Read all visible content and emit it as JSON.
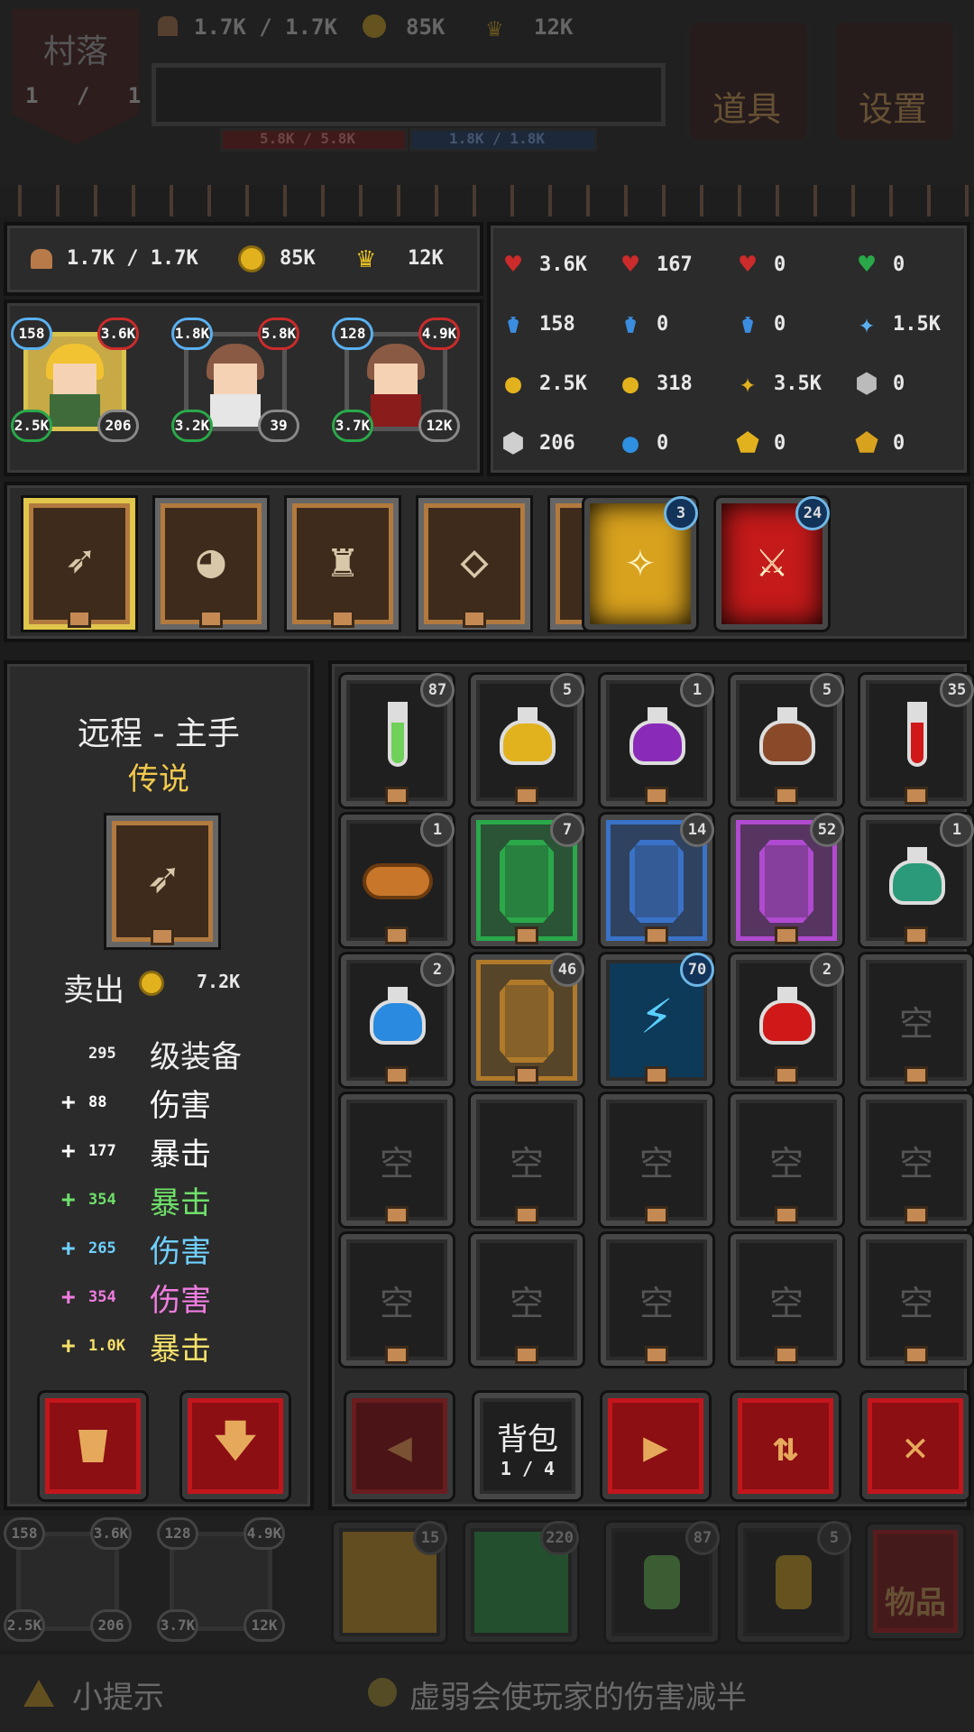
{
  "top": {
    "village": {
      "label": "村落",
      "count": "1 / 1"
    },
    "food": "1.7K / 1.7K",
    "gold": "85K",
    "crown": "12K",
    "hp_bar": "5.8K / 5.8K",
    "mp_bar": "1.8K / 1.8K",
    "items_label": "道具",
    "settings_label": "设置"
  },
  "resources": {
    "food": "1.7K / 1.7K",
    "gold": "85K",
    "crown": "12K"
  },
  "heroes": [
    {
      "tl": "158",
      "tr": "3.6K",
      "bl": "2.5K",
      "br": "206",
      "selected": true,
      "hair": "#f1c232",
      "cloth": "#3f6b3a"
    },
    {
      "tl": "1.8K",
      "tr": "5.8K",
      "bl": "3.2K",
      "br": "39",
      "selected": false,
      "hair": "#8a5a44",
      "cloth": "#e6e6e6"
    },
    {
      "tl": "128",
      "tr": "4.9K",
      "bl": "3.7K",
      "br": "12K",
      "selected": false,
      "hair": "#8a5a44",
      "cloth": "#8a1c1c"
    }
  ],
  "stats": [
    {
      "icon": "max-hp-icon",
      "glyph": "♥",
      "color": "#cc2b2b",
      "value": "3.6K"
    },
    {
      "icon": "hp-regen-icon",
      "glyph": "♥",
      "color": "#cc2b2b",
      "value": "167"
    },
    {
      "icon": "hp-steal-icon",
      "glyph": "♥",
      "color": "#cc2b2b",
      "value": "0"
    },
    {
      "icon": "green-heart-icon",
      "glyph": "♥",
      "color": "#2aa84a",
      "value": "0"
    },
    {
      "icon": "max-mp-icon",
      "glyph": "⚱",
      "color": "#3b8de0",
      "value": "158"
    },
    {
      "icon": "mp-regen-icon",
      "glyph": "⚱",
      "color": "#3b8de0",
      "value": "0"
    },
    {
      "icon": "mp-steal-icon",
      "glyph": "⚱",
      "color": "#3b8de0",
      "value": "0"
    },
    {
      "icon": "blue-star-icon",
      "glyph": "✦",
      "color": "#5ab0f0",
      "value": "1.5K"
    },
    {
      "icon": "gold-damage-icon",
      "glyph": "●",
      "color": "#e2b21e",
      "value": "2.5K"
    },
    {
      "icon": "gold-coin-icon",
      "glyph": "●",
      "color": "#e2b21e",
      "value": "318"
    },
    {
      "icon": "gold-star-icon",
      "glyph": "✦",
      "color": "#e2b21e",
      "value": "3.5K"
    },
    {
      "icon": "silver-shield-icon",
      "glyph": "⬢",
      "color": "#bbbbbb",
      "value": "0"
    },
    {
      "icon": "silver-armor-icon",
      "glyph": "⬢",
      "color": "#cfcfcf",
      "value": "206"
    },
    {
      "icon": "blue-orb-icon",
      "glyph": "●",
      "color": "#2f8fe0",
      "value": "0"
    },
    {
      "icon": "blue-shield-icon",
      "glyph": "⬟",
      "color": "#e2b21e",
      "value": "0"
    },
    {
      "icon": "gold-shield-icon",
      "glyph": "⬟",
      "color": "#d9a21e",
      "value": "0"
    }
  ],
  "equipment": [
    {
      "name": "bow-icon",
      "glyph": "➶",
      "selected": true
    },
    {
      "name": "helmet-icon",
      "glyph": "◕",
      "selected": false
    },
    {
      "name": "armor-icon",
      "glyph": "♜",
      "selected": false
    },
    {
      "name": "necklace-icon",
      "glyph": "◇",
      "selected": false
    },
    {
      "name": "ring-icon",
      "glyph": "◆",
      "selected": false
    }
  ],
  "skills": [
    {
      "name": "holy-skill-icon",
      "badge": "3",
      "color": "#d9a21e"
    },
    {
      "name": "fire-sword-skill-icon",
      "badge": "24",
      "color": "#c41a1a"
    }
  ],
  "detail": {
    "title": "远程 - 主手",
    "rarity": "传说",
    "sell_label": "卖出",
    "sell_price": "7.2K",
    "level": "295",
    "level_text": "级装备",
    "lines": [
      {
        "amount": "88",
        "text": "伤害",
        "color": "#ffffff"
      },
      {
        "amount": "177",
        "text": "暴击",
        "color": "#ffffff"
      },
      {
        "amount": "354",
        "text": "暴击",
        "color": "#6fe06a"
      },
      {
        "amount": "265",
        "text": "伤害",
        "color": "#6fd0ff"
      },
      {
        "amount": "354",
        "text": "伤害",
        "color": "#f07de0"
      },
      {
        "amount": "1.0K",
        "text": "暴击",
        "color": "#f5e06a"
      }
    ]
  },
  "bag": {
    "label": "背包",
    "page": "1 / 4",
    "empty_label": "空",
    "items": [
      {
        "kind": "vial",
        "color": "#6fd05a",
        "badge": "87"
      },
      {
        "kind": "flask",
        "color": "#e2b21e",
        "badge": "5"
      },
      {
        "kind": "flask",
        "color": "#8a2ab8",
        "badge": "1"
      },
      {
        "kind": "flask",
        "color": "#8a4a2a",
        "badge": "5"
      },
      {
        "kind": "vial",
        "color": "#d01818",
        "badge": "35"
      },
      {
        "kind": "bread",
        "color": "#c8762a",
        "badge": "1"
      },
      {
        "kind": "gem",
        "color": "#2aa84a",
        "badge": "7"
      },
      {
        "kind": "gem",
        "color": "#3a72c8",
        "badge": "14"
      },
      {
        "kind": "gem",
        "color": "#b04ad0",
        "badge": "52"
      },
      {
        "kind": "flask",
        "color": "#2a9a7a",
        "badge": "1"
      },
      {
        "kind": "flask",
        "color": "#2a8ae0",
        "badge": "2"
      },
      {
        "kind": "gem",
        "color": "#b07a2a",
        "badge": "46"
      },
      {
        "kind": "rune",
        "color": "#5ad0ff",
        "badge": "70"
      },
      {
        "kind": "flask",
        "color": "#d01818",
        "badge": "2"
      }
    ]
  },
  "quickbar": {
    "heroes": [
      {
        "tl": "158",
        "tr": "3.6K",
        "bl": "2.5K",
        "br": "206"
      },
      {
        "tl": "128",
        "tr": "4.9K",
        "bl": "3.7K",
        "br": "12K"
      }
    ],
    "skills": [
      {
        "badge": "15",
        "color": "#d9a21e"
      },
      {
        "badge": "220",
        "color": "#2aa84a"
      }
    ],
    "items": [
      {
        "badge": "87",
        "color": "#6fd05a"
      },
      {
        "badge": "5",
        "color": "#e2b21e"
      }
    ],
    "items_button": "物品"
  },
  "tip": {
    "label": "小提示",
    "text": "虚弱会使玩家的伤害减半"
  }
}
